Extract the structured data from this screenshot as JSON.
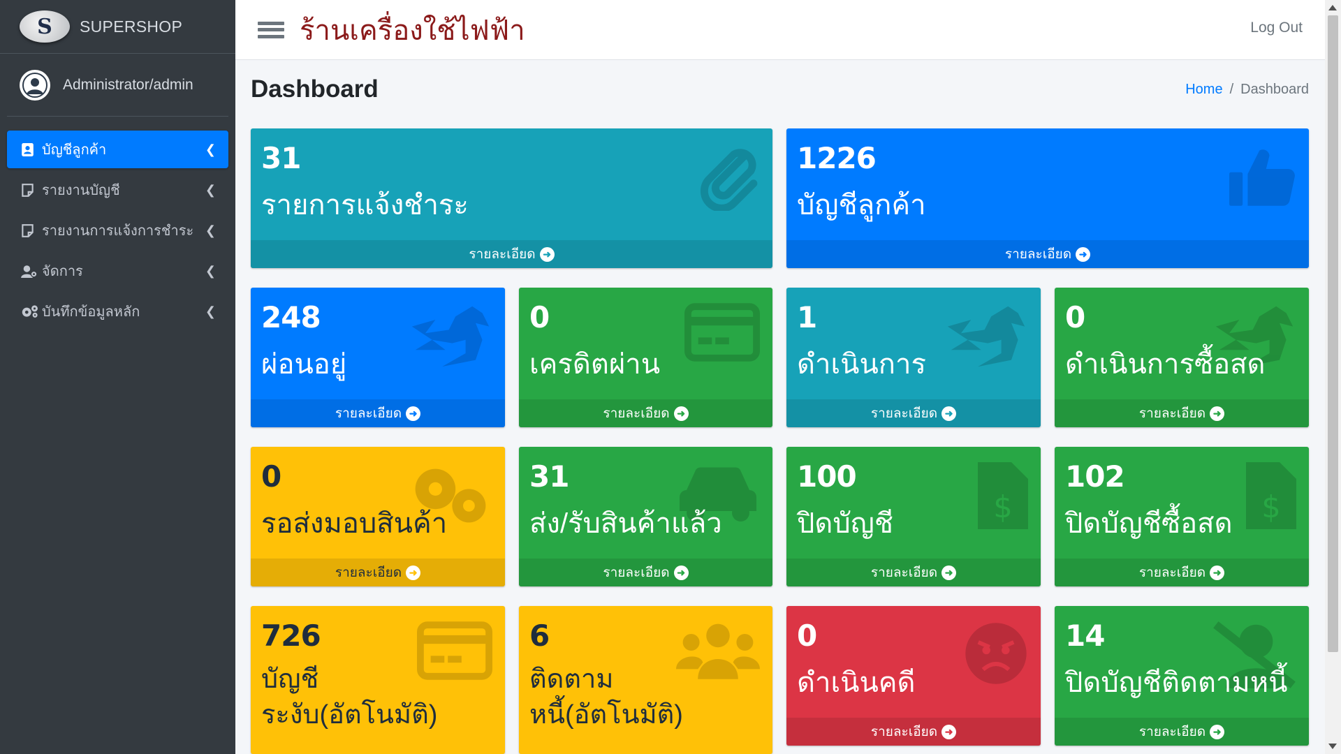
{
  "brand": {
    "name": "SUPERSHOP",
    "logo_letter": "S"
  },
  "user": {
    "name": "Administrator/admin"
  },
  "sidebar": {
    "items": [
      {
        "label": "บัญชีลูกค้า",
        "icon": "address-card-icon",
        "active": true
      },
      {
        "label": "รายงานบัญชี",
        "icon": "note-icon",
        "active": false
      },
      {
        "label": "รายงานการแจ้งการชำระ",
        "icon": "note-icon",
        "active": false
      },
      {
        "label": "จัดการ",
        "icon": "user-cog-icon",
        "active": false
      },
      {
        "label": "บันทึกข้อมูลหลัก",
        "icon": "cogs-icon",
        "active": false
      }
    ]
  },
  "header": {
    "shop_title": "ร้านเครื่องใช้ไฟฟ้า",
    "logout_label": "Log Out"
  },
  "page": {
    "title": "Dashboard"
  },
  "breadcrumb": {
    "home": "Home",
    "sep": "/",
    "current": "Dashboard"
  },
  "footer_label": "รายละเอียด",
  "boxes": [
    {
      "value": "31",
      "label": "รายการแจ้งชำระ",
      "color": "info",
      "icon": "paperclip-icon"
    },
    {
      "value": "1226",
      "label": "บัญชีลูกค้า",
      "color": "primary",
      "icon": "thumbs-up-icon"
    },
    {
      "value": "248",
      "label": "ผ่อนอยู่",
      "color": "primary",
      "icon": "dragon-icon"
    },
    {
      "value": "0",
      "label": "เครดิตผ่าน",
      "color": "success",
      "icon": "credit-card-icon"
    },
    {
      "value": "1",
      "label": "ดำเนินการ",
      "color": "info",
      "icon": "dragon-icon"
    },
    {
      "value": "0",
      "label": "ดำเนินการซื้อสด",
      "color": "success",
      "icon": "dragon-icon"
    },
    {
      "value": "0",
      "label": "รอส่งมอบสินค้า",
      "color": "warning",
      "icon": "cogs-icon"
    },
    {
      "value": "31",
      "label": "ส่ง/รับสินค้าแล้ว",
      "color": "success",
      "icon": "car-icon"
    },
    {
      "value": "100",
      "label": "ปิดบัญชี",
      "color": "success",
      "icon": "invoice-dollar-icon"
    },
    {
      "value": "102",
      "label": "ปิดบัญชีซื้อสด",
      "color": "success",
      "icon": "invoice-dollar-icon"
    },
    {
      "value": "726",
      "label": "บัญชี ระงับ(อัตโนมัติ)",
      "color": "warning",
      "icon": "credit-card-icon"
    },
    {
      "value": "6",
      "label": "ติดตาม หนี้(อัตโนมัติ)",
      "color": "warning",
      "icon": "users-icon"
    },
    {
      "value": "0",
      "label": "ดำเนินคดี",
      "color": "danger",
      "icon": "angry-face-icon"
    },
    {
      "value": "14",
      "label": "ปิดบัญชีติดตามหนี้",
      "color": "success",
      "icon": "user-slash-icon"
    }
  ]
}
